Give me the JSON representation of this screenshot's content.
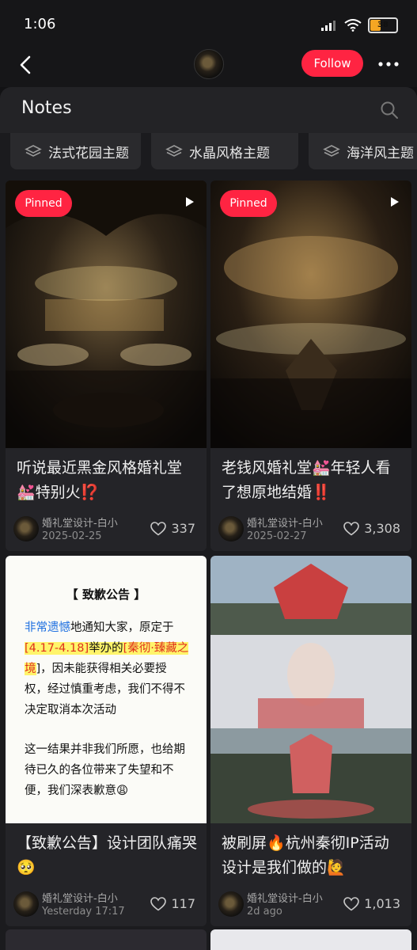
{
  "status_bar": {
    "time": "1:06",
    "battery": "38"
  },
  "nav": {
    "follow_label": "Follow"
  },
  "notes_header": {
    "title": "Notes"
  },
  "chips": [
    "法式花园主题",
    "水晶风格主题",
    "海洋风主题"
  ],
  "cards": [
    {
      "pinned": "Pinned",
      "title": "听说最近黑金风格婚礼堂💒特别火⁉️",
      "author": "婚礼堂设计-白小",
      "date": "2025-02-25",
      "likes": "337"
    },
    {
      "pinned": "Pinned",
      "title": "老钱风婚礼堂💒年轻人看了想原地结婚‼️",
      "author": "婚礼堂设计-白小",
      "date": "2025-02-27",
      "likes": "3,308"
    },
    {
      "title": "【致歉公告】设计团队痛哭🥺",
      "author": "婚礼堂设计-白小",
      "date": "Yesterday 17:17",
      "likes": "117"
    },
    {
      "title": "被刷屏🔥杭州秦彻IP活动设计是我们做的🙋",
      "author": "婚礼堂设计-白小",
      "date": "2d ago",
      "likes": "1,013"
    }
  ],
  "notice_image": {
    "heading": "【 致歉公告 】",
    "seg1": "非常遗憾",
    "seg2": "地通知大家，原定于",
    "seg3": "[4.17-4.18]",
    "seg4": "举办的",
    "seg5": "[秦彻·臻藏之境",
    "seg6": "]，因未能获得相关必要授权，经过慎重考虑，我们不得不决定取消本次活动",
    "para2": "这一结果并非我们所愿，也给期待已久的各位带来了失望和不便，我们深表歉意😩"
  },
  "colors": {
    "accent": "#ff2442",
    "background": "#121214",
    "card": "#242428"
  },
  "icons": [
    "back-arrow-icon",
    "more-dots-icon",
    "search-icon",
    "layers-icon",
    "video-icon",
    "heart-icon"
  ]
}
